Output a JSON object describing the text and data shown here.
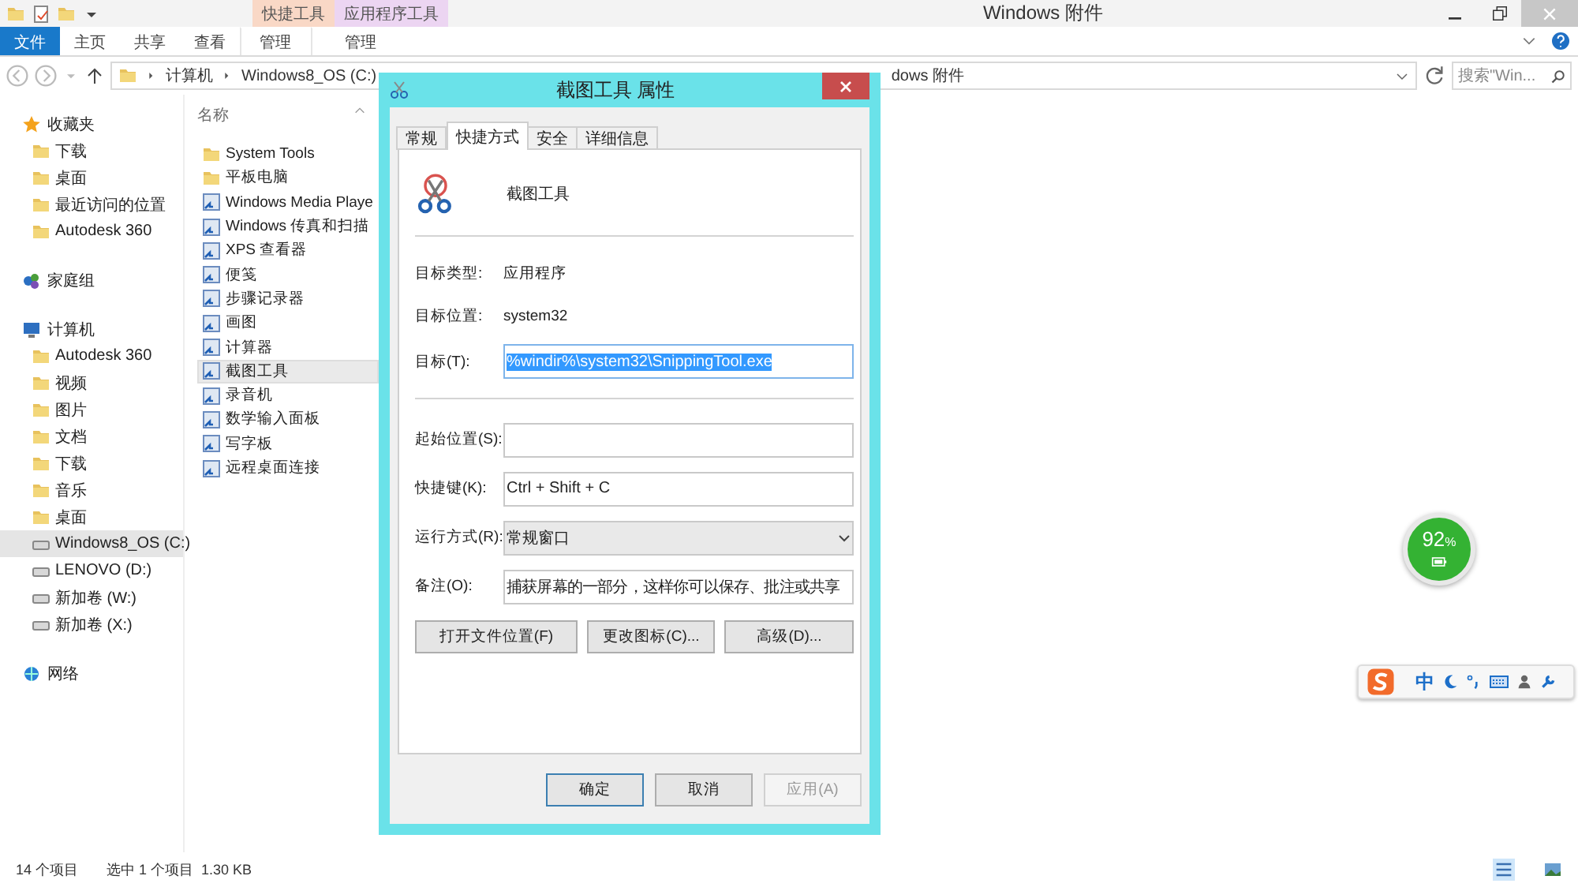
{
  "window": {
    "title": "Windows 附件",
    "context_tabs": [
      {
        "label": "快捷工具",
        "color": "#f9d8c6"
      },
      {
        "label": "应用程序工具",
        "color": "#ecd5f2"
      }
    ]
  },
  "ribbon": {
    "tabs": [
      {
        "label": "文件",
        "selected": true,
        "kind": "file"
      },
      {
        "label": "主页",
        "selected": false,
        "kind": "plain"
      },
      {
        "label": "共享",
        "selected": false,
        "kind": "plain"
      },
      {
        "label": "查看",
        "selected": false,
        "kind": "plain"
      },
      {
        "label": "管理",
        "selected": false,
        "kind": "context"
      },
      {
        "label": "管理",
        "selected": false,
        "kind": "context"
      }
    ]
  },
  "address": {
    "crumbs": [
      "计算机",
      "Windows8_OS (C:)"
    ],
    "tail": "dows 附件",
    "search_placeholder": "搜索\"Win..."
  },
  "sidebar": {
    "groups": [
      {
        "label": "收藏夹",
        "children": [
          {
            "label": "下载",
            "selected": false
          },
          {
            "label": "桌面",
            "selected": false
          },
          {
            "label": "最近访问的位置",
            "selected": false
          },
          {
            "label": "Autodesk 360",
            "selected": false
          }
        ]
      },
      {
        "label": "家庭组"
      },
      {
        "label": "计算机",
        "children": [
          {
            "label": "Autodesk 360",
            "selected": false
          },
          {
            "label": "视频",
            "selected": false
          },
          {
            "label": "图片",
            "selected": false
          },
          {
            "label": "文档",
            "selected": false
          },
          {
            "label": "下载",
            "selected": false
          },
          {
            "label": "音乐",
            "selected": false
          },
          {
            "label": "桌面",
            "selected": false
          },
          {
            "label": "Windows8_OS (C:)",
            "selected": true
          },
          {
            "label": "LENOVO (D:)",
            "selected": false
          },
          {
            "label": "新加卷 (W:)",
            "selected": false
          },
          {
            "label": "新加卷 (X:)",
            "selected": false
          }
        ]
      },
      {
        "label": "网络"
      }
    ]
  },
  "file_list": {
    "column": "名称",
    "items": [
      {
        "name": "System Tools",
        "kind": "folder",
        "selected": false
      },
      {
        "name": "平板电脑",
        "kind": "folder",
        "selected": false
      },
      {
        "name": "Windows Media Playe",
        "kind": "shortcut",
        "selected": false
      },
      {
        "name": "Windows 传真和扫描",
        "kind": "shortcut",
        "selected": false
      },
      {
        "name": "XPS 查看器",
        "kind": "shortcut",
        "selected": false
      },
      {
        "name": "便笺",
        "kind": "shortcut",
        "selected": false
      },
      {
        "name": "步骤记录器",
        "kind": "shortcut",
        "selected": false
      },
      {
        "name": "画图",
        "kind": "shortcut",
        "selected": false
      },
      {
        "name": "计算器",
        "kind": "shortcut",
        "selected": false
      },
      {
        "name": "截图工具",
        "kind": "shortcut",
        "selected": true
      },
      {
        "name": "录音机",
        "kind": "shortcut",
        "selected": false
      },
      {
        "name": "数学输入面板",
        "kind": "shortcut",
        "selected": false
      },
      {
        "name": "写字板",
        "kind": "shortcut",
        "selected": false
      },
      {
        "name": "远程桌面连接",
        "kind": "shortcut",
        "selected": false
      }
    ]
  },
  "status_bar": {
    "count": "14 个项目",
    "selection": "选中 1 个项目  1.30 KB"
  },
  "dialog": {
    "title": "截图工具 属性",
    "tabs": [
      {
        "label": "常规",
        "selected": false
      },
      {
        "label": "快捷方式",
        "selected": true
      },
      {
        "label": "安全",
        "selected": false
      },
      {
        "label": "详细信息",
        "selected": false
      }
    ],
    "app_name": "截图工具",
    "info": [
      {
        "label": "目标类型:",
        "value": "应用程序"
      },
      {
        "label": "目标位置:",
        "value": "system32"
      }
    ],
    "target": {
      "label": "目标(T):",
      "value": "%windir%\\system32\\SnippingTool.exe"
    },
    "fields": [
      {
        "label": "起始位置(S):",
        "kind": "input"
      },
      {
        "label": "快捷键(K):",
        "kind": "input",
        "value": "Ctrl + Shift + C"
      },
      {
        "label": "运行方式(R):",
        "kind": "select",
        "value": "常规窗口"
      },
      {
        "label": "备注(O):",
        "kind": "input",
        "value": "捕获屏幕的一部分，这样你可以保存、批注或共享"
      }
    ],
    "actions": [
      "打开文件位置(F)",
      "更改图标(C)...",
      "高级(D)..."
    ],
    "buttons": [
      {
        "label": "确定",
        "disabled": false
      },
      {
        "label": "取消",
        "disabled": false
      },
      {
        "label": "应用(A)",
        "disabled": true
      }
    ]
  },
  "battery": {
    "reading": "92",
    "unit": "%"
  },
  "ime_bar": {
    "mode": "中"
  }
}
